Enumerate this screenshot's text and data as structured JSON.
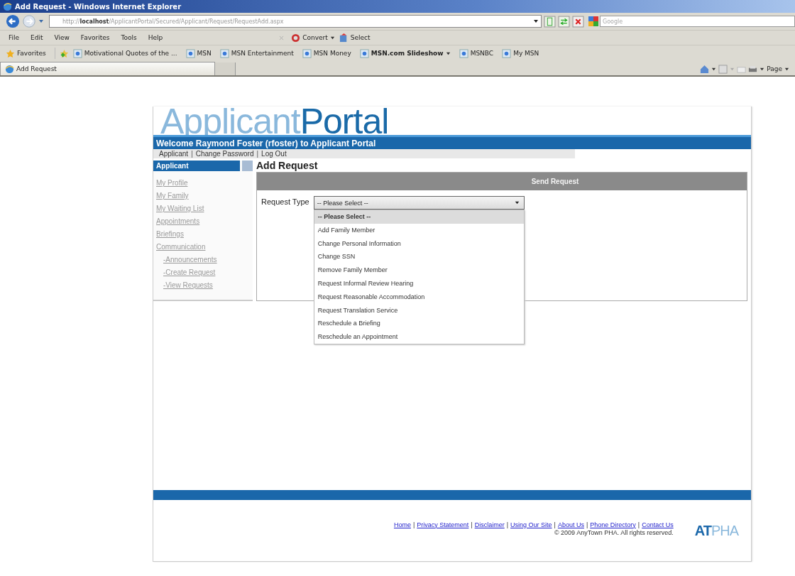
{
  "window": {
    "title": "Add Request - Windows Internet Explorer"
  },
  "address_bar": {
    "url_prefix": "http://",
    "url_host": "localhost",
    "url_path": "/ApplicantPortal/Secured/Applicant/Request/RequestAdd.aspx",
    "search_placeholder": "Google"
  },
  "menu": [
    "File",
    "Edit",
    "View",
    "Favorites",
    "Tools",
    "Help"
  ],
  "command_toolbar": [
    {
      "label": "Convert",
      "kind": "dropdown"
    },
    {
      "label": "Select",
      "kind": "button"
    }
  ],
  "favorites_bar": {
    "label": "Favorites",
    "links": [
      {
        "label": "Motivational Quotes of the ...",
        "bold": false,
        "dropdown": false
      },
      {
        "label": "MSN",
        "bold": false,
        "dropdown": false
      },
      {
        "label": "MSN Entertainment",
        "bold": false,
        "dropdown": false
      },
      {
        "label": "MSN Money",
        "bold": false,
        "dropdown": false
      },
      {
        "label": "MSN.com Slideshow",
        "bold": true,
        "dropdown": true
      },
      {
        "label": "MSNBC",
        "bold": false,
        "dropdown": false
      },
      {
        "label": "My MSN",
        "bold": false,
        "dropdown": false
      }
    ]
  },
  "tabs": [
    {
      "label": "Add Request",
      "selected": true
    }
  ],
  "page_menu": {
    "label": "Page"
  },
  "site": {
    "logo_light": "Applicant",
    "logo_dark": "Portal",
    "welcome": "Welcome Raymond Foster (rfoster) to Applicant Portal",
    "separator": "|",
    "top_links": [
      "Applicant",
      "Change Password",
      "Log Out"
    ],
    "sidebar": {
      "header": "Applicant",
      "items": [
        {
          "label": "My Profile"
        },
        {
          "label": "My Family"
        },
        {
          "label": "My Waiting List"
        },
        {
          "label": "Appointments"
        },
        {
          "label": "Briefings"
        },
        {
          "label": "Communication",
          "children": [
            {
              "label": "-Announcements"
            },
            {
              "label": "-Create Request"
            },
            {
              "label": "-View Requests"
            }
          ]
        }
      ]
    },
    "heading": "Add Request",
    "panel_title": "Send Request",
    "form": {
      "label": "Request Type",
      "value": "-- Please Select --",
      "expanded": true,
      "options": [
        {
          "label": "-- Please Select --",
          "selected": true
        },
        {
          "label": "Add Family Member",
          "selected": false
        },
        {
          "label": "Change Personal Information",
          "selected": false
        },
        {
          "label": "Change SSN",
          "selected": false
        },
        {
          "label": "Remove Family Member",
          "selected": false
        },
        {
          "label": "Request Informal Review Hearing",
          "selected": false
        },
        {
          "label": "Request Reasonable Accommodation",
          "selected": false
        },
        {
          "label": "Request Translation Service",
          "selected": false
        },
        {
          "label": "Reschedule a Briefing",
          "selected": false
        },
        {
          "label": "Reschedule an Appointment",
          "selected": false
        }
      ]
    },
    "footer_links": [
      "Home",
      "Privacy Statement",
      "Disclaimer",
      "Using Our Site",
      "About Us",
      "Phone Directory",
      "Contact Us"
    ],
    "copyright": "© 2009 AnyTown PHA. All rights reserved.",
    "footer_logo_dark": "AT",
    "footer_logo_light": "PHA"
  }
}
